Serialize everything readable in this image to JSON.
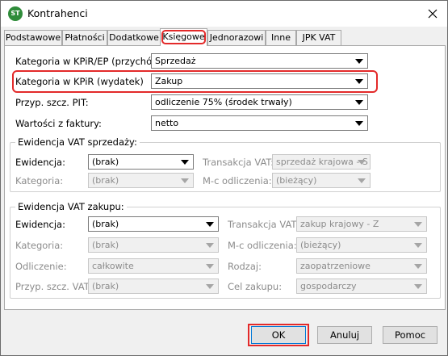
{
  "window": {
    "title": "Kontrahenci",
    "app_icon_text": "ST"
  },
  "tabs": [
    {
      "label": "Podstawowe"
    },
    {
      "label": "Płatności"
    },
    {
      "label": "Dodatkowe"
    },
    {
      "label": "Księgowe",
      "active": true
    },
    {
      "label": "Jednorazowi"
    },
    {
      "label": "Inne"
    },
    {
      "label": "JPK VAT"
    }
  ],
  "ksiegowe": {
    "kat_przychod": {
      "label": "Kategoria w KPiR/EP (przychód):",
      "value": "Sprzedaż"
    },
    "kat_wydatek": {
      "label": "Kategoria w KPiR (wydatek)",
      "value": "Zakup"
    },
    "przyp_pit": {
      "label": "Przyp. szcz. PIT:",
      "value": "odliczenie 75% (środek trwały)"
    },
    "wartosci": {
      "label": "Wartości z faktury:",
      "value": "netto"
    }
  },
  "vat_sprzedazy": {
    "title": "Ewidencja VAT sprzedaży:",
    "ewidencja": {
      "label": "Ewidencja:",
      "value": "(brak)"
    },
    "transakcja": {
      "label": "Transakcja VAT:",
      "value": "sprzedaż krajowa - S"
    },
    "kategoria": {
      "label": "Kategoria:",
      "value": "(brak)"
    },
    "mc_odliczenia": {
      "label": "M-c odliczenia:",
      "value": "(bieżący)"
    }
  },
  "vat_zakupu": {
    "title": "Ewidencja VAT zakupu:",
    "ewidencja": {
      "label": "Ewidencja:",
      "value": "(brak)"
    },
    "transakcja": {
      "label": "Transakcja VAT:",
      "value": "zakup krajowy - Z"
    },
    "kategoria": {
      "label": "Kategoria:",
      "value": "(brak)"
    },
    "mc_odliczenia": {
      "label": "M-c odliczenia:",
      "value": "(bieżący)"
    },
    "odliczenie": {
      "label": "Odliczenie:",
      "value": "całkowite"
    },
    "rodzaj": {
      "label": "Rodzaj:",
      "value": "zaopatrzeniowe"
    },
    "przyp_vat": {
      "label": "Przyp. szcz. VAT:",
      "value": "(brak)"
    },
    "cel_zakupu": {
      "label": "Cel zakupu:",
      "value": "gospodarczy"
    }
  },
  "buttons": {
    "ok": "OK",
    "cancel": "Anuluj",
    "help": "Pomoc"
  },
  "colors": {
    "highlight": "#e32a2a",
    "focus_border": "#0078d7",
    "app_icon": "#2f8c3a"
  }
}
